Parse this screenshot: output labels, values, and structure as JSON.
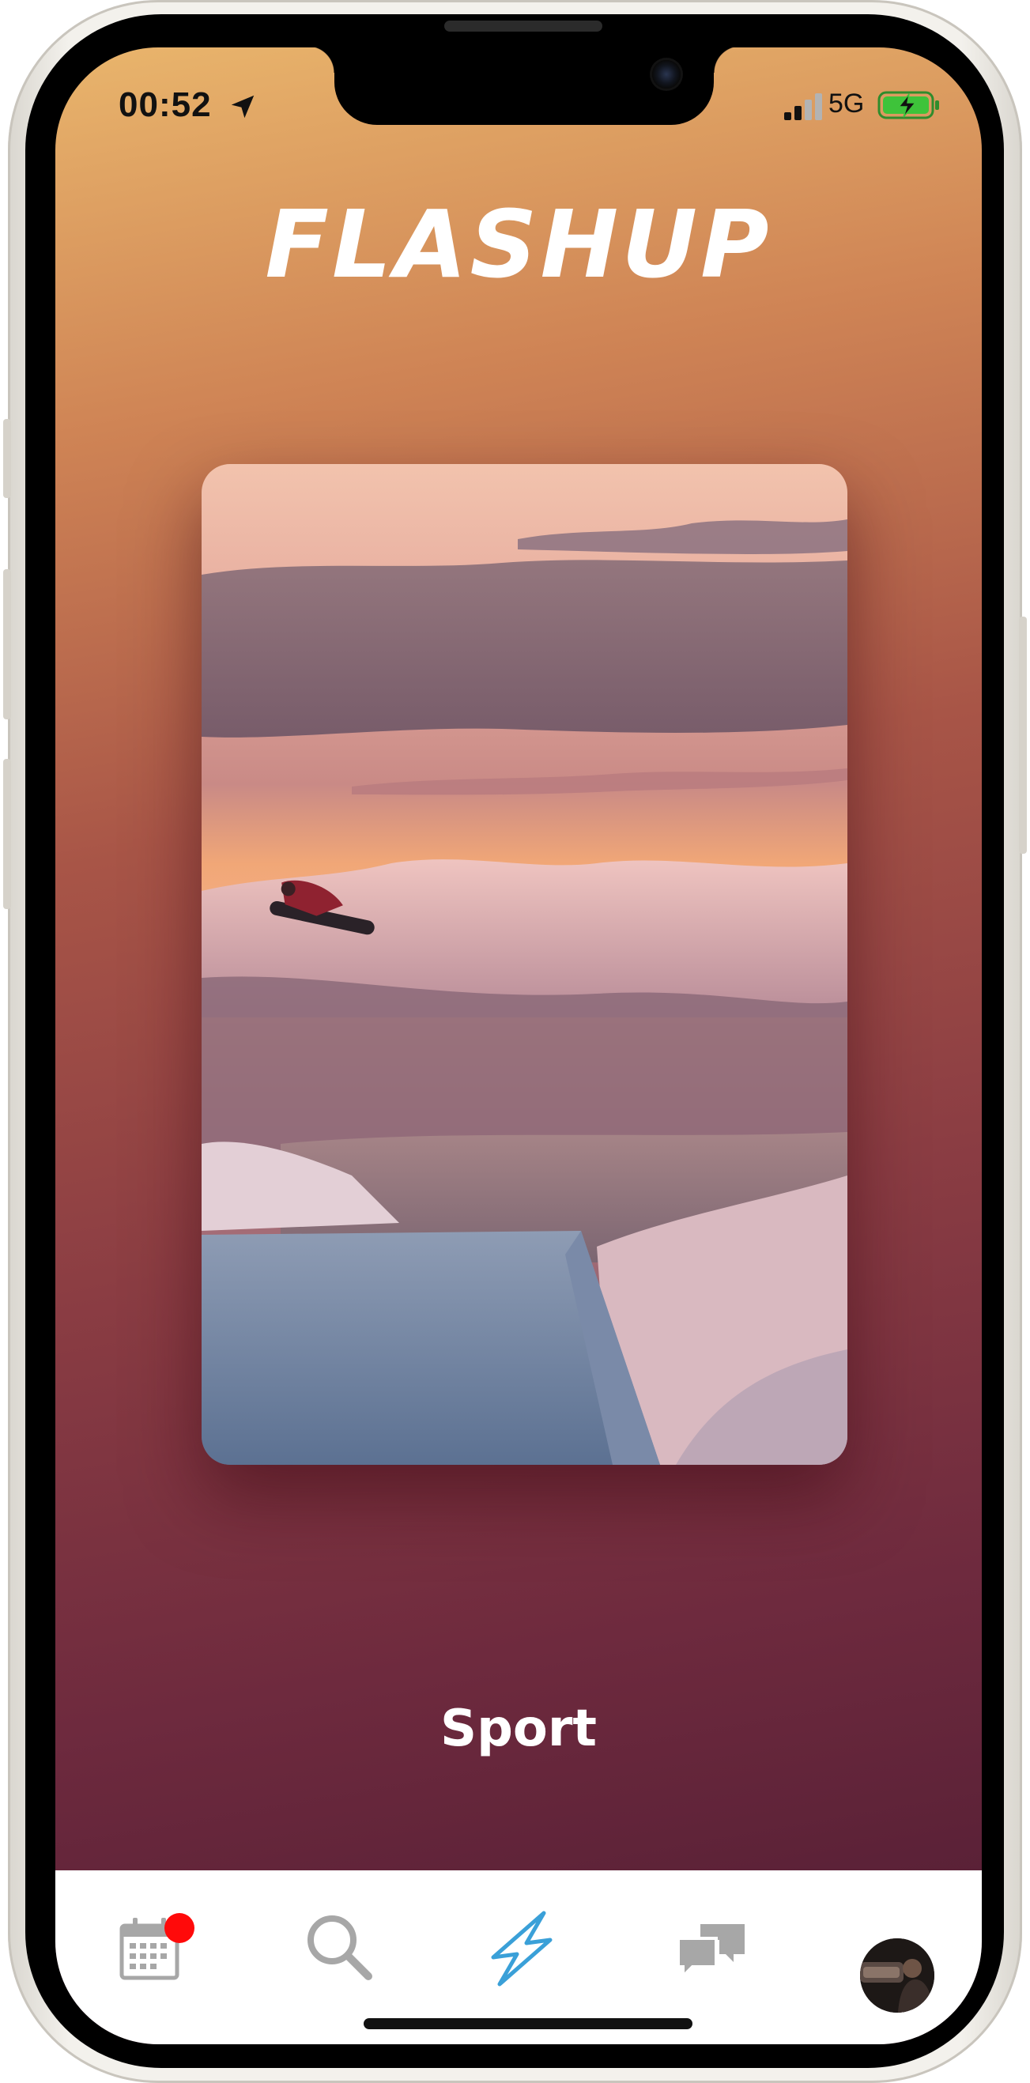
{
  "status_bar": {
    "time": "00:52",
    "network": "5G",
    "icons": [
      "location-arrow-icon",
      "cellular-signal-icon",
      "battery-charging-icon"
    ]
  },
  "header": {
    "app_title": "FLASHUP"
  },
  "card": {
    "image": "snowboarder-jump-photo"
  },
  "category": {
    "label": "Sport"
  },
  "tabbar": {
    "tabs": [
      {
        "icon": "calendar-icon",
        "has_badge": true
      },
      {
        "icon": "search-icon"
      },
      {
        "icon": "flash-icon",
        "active": true
      },
      {
        "icon": "chat-bubbles-icon"
      },
      {
        "icon": "profile-avatar"
      }
    ],
    "active_color": "#3aa0d8",
    "inactive_color": "#a7a7a7",
    "badge_color": "#ff0a0a"
  }
}
